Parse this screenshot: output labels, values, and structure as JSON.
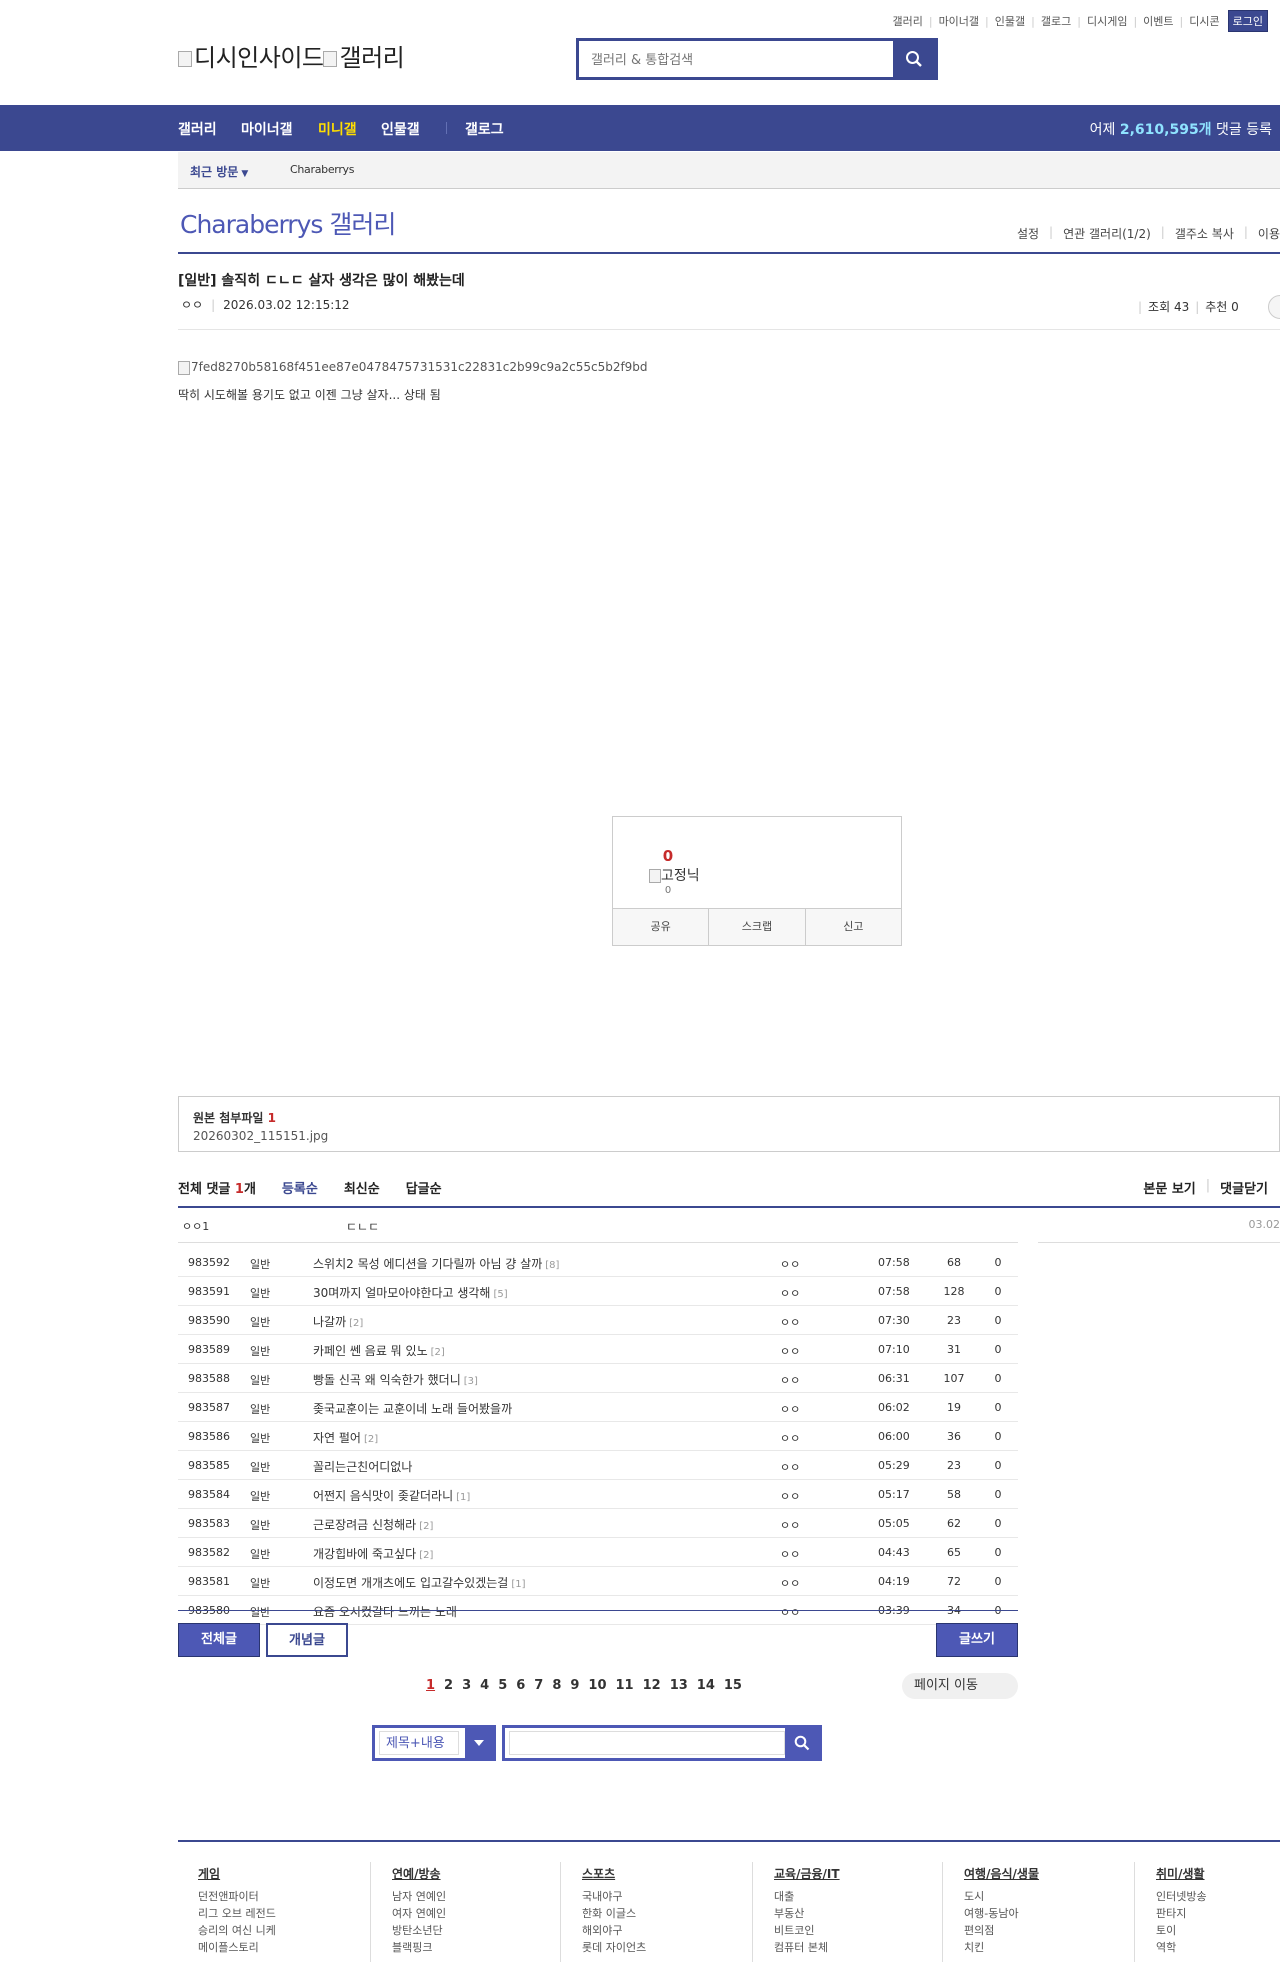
{
  "top_links": [
    "갤러리",
    "마이너갤",
    "인물갤",
    "갤로그",
    "디시게임",
    "이벤트",
    "디시콘"
  ],
  "login_label": "로그인",
  "logo": {
    "brand": "디시인사이드",
    "section": "갤러리"
  },
  "search": {
    "placeholder": "갤러리 & 통합검색"
  },
  "nav": {
    "items": [
      "갤러리",
      "마이너갤",
      "미니갤",
      "인물갤",
      "갤로그"
    ],
    "stat_prefix": "어제 ",
    "stat_number": "2,610,595개",
    "stat_suffix": " 댓글 등록"
  },
  "recent": {
    "label": "최근 방문",
    "gallery": "Charaberrys"
  },
  "gallery": {
    "title": "Charaberrys 갤러리",
    "menu": [
      "설정",
      "연관 갤러리(1/2)",
      "갤주소 복사",
      "이용"
    ]
  },
  "post": {
    "title": "[일반] 솔직히 ㄷㄴㄷ 살자 생각은 많이 해봤는데",
    "writer": "ㅇㅇ",
    "datetime": "2026.03.02 12:15:12",
    "views": "조회 43",
    "recommend": "추천 0",
    "image_alt": "7fed8270b58168f451ee87e0478475731531c22831c2b99c9a2c55c5b2f9bd",
    "body": "딱히 시도해볼 용기도 없고 이젠 그냥 살자... 상태 됨"
  },
  "vote": {
    "count": "0",
    "nick_alt": "고정닉",
    "nick_count": "0",
    "buttons": [
      "공유",
      "스크랩",
      "신고"
    ]
  },
  "attachment": {
    "label": "원본 첨부파일",
    "count": "1",
    "file": "20260302_115151.jpg"
  },
  "comments": {
    "label": "전체 댓글",
    "count": "1",
    "unit": "개",
    "sorts": [
      "등록순",
      "최신순",
      "답글순"
    ],
    "right": [
      "본문 보기",
      "댓글닫기"
    ],
    "items": [
      {
        "nick": "ㅇㅇ1",
        "text": "ㄷㄴㄷ",
        "date": "03.02"
      }
    ]
  },
  "list": [
    {
      "no": "983592",
      "head": "일반",
      "title": "스위치2 목성 에디션을 기다릴까 아님 걍 살까",
      "reply": "[8]",
      "writer": "ㅇㅇ",
      "date": "07:58",
      "views": "68",
      "rec": "0"
    },
    {
      "no": "983591",
      "head": "일반",
      "title": "30며까지 얼마모아야한다고 생각해",
      "reply": "[5]",
      "writer": "ㅇㅇ",
      "date": "07:58",
      "views": "128",
      "rec": "0"
    },
    {
      "no": "983590",
      "head": "일반",
      "title": "나갈까",
      "reply": "[2]",
      "writer": "ㅇㅇ",
      "date": "07:30",
      "views": "23",
      "rec": "0"
    },
    {
      "no": "983589",
      "head": "일반",
      "title": "카페인 쎈 음료 뭐 있노",
      "reply": "[2]",
      "writer": "ㅇㅇ",
      "date": "07:10",
      "views": "31",
      "rec": "0"
    },
    {
      "no": "983588",
      "head": "일반",
      "title": "빵돌 신곡 왜 익숙한가 했더니",
      "reply": "[3]",
      "writer": "ㅇㅇ",
      "date": "06:31",
      "views": "107",
      "rec": "0"
    },
    {
      "no": "983587",
      "head": "일반",
      "title": "좆국교훈이는 교훈이네 노래 들어봤을까",
      "reply": "",
      "writer": "ㅇㅇ",
      "date": "06:02",
      "views": "19",
      "rec": "0"
    },
    {
      "no": "983586",
      "head": "일반",
      "title": "자연 펄어",
      "reply": "[2]",
      "writer": "ㅇㅇ",
      "date": "06:00",
      "views": "36",
      "rec": "0"
    },
    {
      "no": "983585",
      "head": "일반",
      "title": "꼴리는근친어디없나",
      "reply": "",
      "writer": "ㅇㅇ",
      "date": "05:29",
      "views": "23",
      "rec": "0"
    },
    {
      "no": "983584",
      "head": "일반",
      "title": "어쩐지 음식맛이 좆같더라니",
      "reply": "[1]",
      "writer": "ㅇㅇ",
      "date": "05:17",
      "views": "58",
      "rec": "0"
    },
    {
      "no": "983583",
      "head": "일반",
      "title": "근로장려금 신청해라",
      "reply": "[2]",
      "writer": "ㅇㅇ",
      "date": "05:05",
      "views": "62",
      "rec": "0"
    },
    {
      "no": "983582",
      "head": "일반",
      "title": "개강힙바에 죽고싶다",
      "reply": "[2]",
      "writer": "ㅇㅇ",
      "date": "04:43",
      "views": "65",
      "rec": "0"
    },
    {
      "no": "983581",
      "head": "일반",
      "title": "이정도면 개개츠에도 입고갈수있겠는걸",
      "reply": "[1]",
      "writer": "ㅇㅇ",
      "date": "04:19",
      "views": "72",
      "rec": "0"
    },
    {
      "no": "983580",
      "head": "일반",
      "title": "요즘 오시컸갈다 느끼는 노래",
      "reply": "",
      "writer": "ㅇㅇ",
      "date": "03:39",
      "views": "34",
      "rec": "0"
    }
  ],
  "buttons": {
    "all": "전체글",
    "best": "개념글",
    "write": "글쓰기"
  },
  "pager": {
    "pages": [
      "1",
      "2",
      "3",
      "4",
      "5",
      "6",
      "7",
      "8",
      "9",
      "10",
      "11",
      "12",
      "13",
      "14",
      "15"
    ],
    "current": "1",
    "goto": "페이지 이동"
  },
  "bottom_search": {
    "scope": "제목+내용"
  },
  "footer": {
    "categories": [
      {
        "title": "게임",
        "items": [
          "던전앤파이터",
          "리그 오브 레전드",
          "승리의 여신 니케",
          "메이플스토리"
        ]
      },
      {
        "title": "연예/방송",
        "items": [
          "남자 연예인",
          "여자 연예인",
          "방탄소년단",
          "블랙핑크"
        ]
      },
      {
        "title": "스포츠",
        "items": [
          "국내야구",
          "한화 이글스",
          "해외야구",
          "롯데 자이언츠"
        ]
      },
      {
        "title": "교육/금융/IT",
        "items": [
          "대출",
          "부동산",
          "비트코인",
          "컴퓨터 본체"
        ]
      },
      {
        "title": "여행/음식/생물",
        "items": [
          "도시",
          "여행-동남아",
          "편의점",
          "치킨"
        ]
      },
      {
        "title": "취미/생활",
        "items": [
          "인터넷방송",
          "판타지",
          "토이",
          "역학"
        ]
      }
    ]
  },
  "colors": {
    "brand": "#3b4890",
    "accent": "#4d58b5",
    "highlight": "#ffde00",
    "red": "#c62b2b"
  }
}
